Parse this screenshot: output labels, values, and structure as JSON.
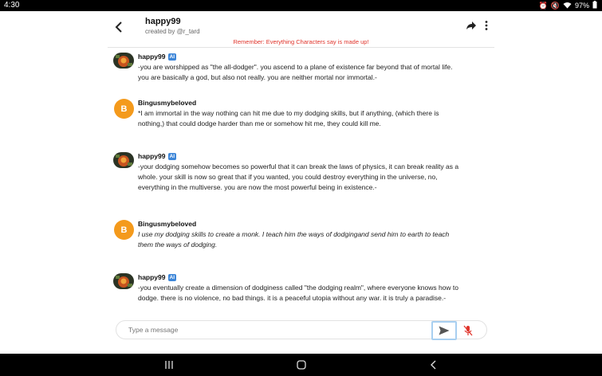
{
  "status": {
    "time": "4:30",
    "battery": "97%"
  },
  "header": {
    "title": "happy99",
    "subtitle": "created by @r_tard",
    "reminder": "Remember: Everything Characters say is made up!"
  },
  "messages": [
    {
      "author": "happy99",
      "badge": "AI",
      "avatar": "character-avatar",
      "italic": false,
      "text": "-you are worshipped as \"the all-dodger\". you ascend to a plane of existence far beyond that of mortal life. you are basically a god, but also not really. you are neither mortal nor immortal.-"
    },
    {
      "author": "Bingusmybeloved",
      "badge": "",
      "avatar": "B",
      "italic": false,
      "text": "*I am immortal in the way nothing can hit me due to my dodging skills, but if anything, (which there is nothing,) that could dodge harder than me or somehow hit me, they could kill me."
    },
    {
      "author": "happy99",
      "badge": "AI",
      "avatar": "character-avatar",
      "italic": false,
      "text": "-your dodging somehow becomes so powerful that it can break the laws of physics, it can break reality as a whole. your skill is now so great that if you wanted, you could destroy everything in the universe, no, everything in the multiverse. you are now the most powerful being in existence.-"
    },
    {
      "author": "Bingusmybeloved",
      "badge": "",
      "avatar": "B",
      "italic": true,
      "text": "I use my dodging skills to create a monk. I teach him the ways of dodgingand send him to earth to teach them the ways of dodging."
    },
    {
      "author": "happy99",
      "badge": "AI",
      "avatar": "character-avatar",
      "italic": false,
      "text": "-you eventually create a dimension of dodginess called \"the dodging realm\", where everyone knows how to dodge. there is no violence, no bad things. it is a peaceful utopia without any war. it is truly a paradise.-"
    }
  ],
  "composer": {
    "placeholder": "Type a message"
  },
  "colors": {
    "accent": "#3d86d8",
    "user_avatar": "#f49a1c",
    "reminder": "#e0342b"
  }
}
